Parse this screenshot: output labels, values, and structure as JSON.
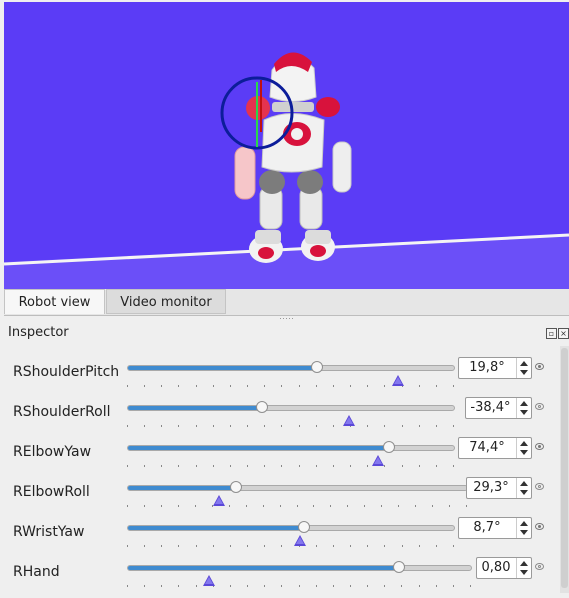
{
  "tabs": [
    {
      "label": "Robot view",
      "active": true
    },
    {
      "label": "Video monitor",
      "active": false
    }
  ],
  "inspector": {
    "title": "Inspector"
  },
  "joints": [
    {
      "name": "RShoulderPitch",
      "value": "19,8°",
      "slider_fraction": 0.58,
      "target_fraction": 0.83,
      "eye_icon": "eye-visible-icon"
    },
    {
      "name": "RShoulderRoll",
      "value": "-38,4°",
      "slider_fraction": 0.41,
      "target_fraction": 0.68,
      "eye_icon": "eye-hidden-icon"
    },
    {
      "name": "RElbowYaw",
      "value": "74,4°",
      "slider_fraction": 0.8,
      "target_fraction": 0.77,
      "eye_icon": "eye-visible-icon"
    },
    {
      "name": "RElbowRoll",
      "value": "29,3°",
      "slider_fraction": 0.32,
      "target_fraction": 0.27,
      "eye_icon": "eye-hidden-icon"
    },
    {
      "name": "RWristYaw",
      "value": "8,7°",
      "slider_fraction": 0.54,
      "target_fraction": 0.53,
      "eye_icon": "eye-visible-icon"
    },
    {
      "name": "RHand",
      "value": "0,80",
      "slider_fraction": 0.79,
      "target_fraction": 0.24,
      "eye_icon": "eye-hidden-icon"
    }
  ],
  "colors": {
    "viewport_background": "#5b3cf6",
    "slider_fill": "#3f8bd0",
    "target_marker": "#5a48d8",
    "robot_accent": "#d8123c"
  }
}
